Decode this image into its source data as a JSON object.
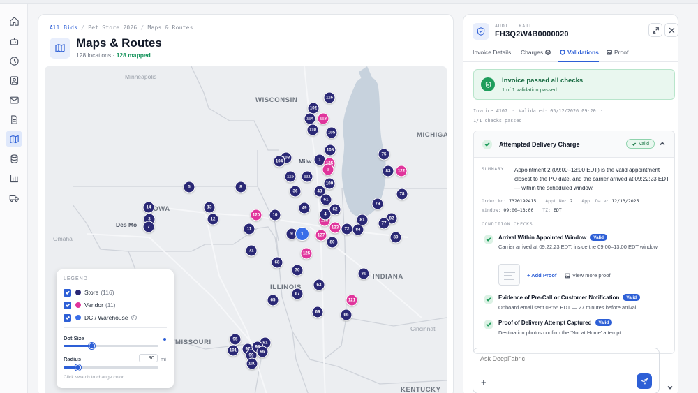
{
  "nav": {
    "items": [
      {
        "id": "home",
        "icon": "home-icon",
        "active": false
      },
      {
        "id": "bot",
        "icon": "robot-icon",
        "active": false
      },
      {
        "id": "history",
        "icon": "clock-icon",
        "active": false
      },
      {
        "id": "contacts",
        "icon": "contact-card-icon",
        "active": false
      },
      {
        "id": "mail",
        "icon": "mail-icon",
        "active": false
      },
      {
        "id": "documents",
        "icon": "document-icon",
        "active": false
      },
      {
        "id": "map",
        "icon": "map-icon",
        "active": true
      },
      {
        "id": "database",
        "icon": "database-icon",
        "active": false
      },
      {
        "id": "analytics",
        "icon": "bar-chart-icon",
        "active": false
      },
      {
        "id": "shipping",
        "icon": "truck-icon",
        "active": false
      }
    ],
    "active_color": "#2d5fd6"
  },
  "breadcrumb": {
    "root": "All Bids",
    "project": "Pet Store 2026",
    "current": "Maps & Routes",
    "separator": "/"
  },
  "page": {
    "title": "Maps & Routes",
    "locations": "128 locations",
    "dot": "·",
    "mapped": "128 mapped"
  },
  "map": {
    "labels": [
      {
        "kind": "place",
        "text": "Minneapolis"
      },
      {
        "kind": "state",
        "text": "WISCONSIN"
      },
      {
        "kind": "state",
        "text": "MICHIGA"
      },
      {
        "kind": "state",
        "text": "IOWA"
      },
      {
        "kind": "city",
        "text": "Des Mo"
      },
      {
        "kind": "place",
        "text": "Omaha"
      },
      {
        "kind": "city",
        "text": "Milw"
      },
      {
        "kind": "state",
        "text": "ILLINOIS"
      },
      {
        "kind": "state",
        "text": "INDIANA"
      },
      {
        "kind": "state",
        "text": "MISSOURI"
      },
      {
        "kind": "place",
        "text": "Cincinnati"
      },
      {
        "kind": "state",
        "text": "KENTUCKY"
      }
    ],
    "markers": [
      {
        "label": "116",
        "type": "store"
      },
      {
        "label": "102",
        "type": "store"
      },
      {
        "label": "114",
        "type": "store"
      },
      {
        "label": "118",
        "type": "vendor"
      },
      {
        "label": "110",
        "type": "store"
      },
      {
        "label": "105",
        "type": "store"
      },
      {
        "label": "108",
        "type": "store"
      },
      {
        "label": "103",
        "type": "store"
      },
      {
        "label": "104",
        "type": "store"
      },
      {
        "label": "1",
        "type": "store"
      },
      {
        "label": "135",
        "type": "vendor"
      },
      {
        "label": "1",
        "type": "vendor"
      },
      {
        "label": "111",
        "type": "store"
      },
      {
        "label": "115",
        "type": "store"
      },
      {
        "label": "109",
        "type": "store"
      },
      {
        "label": "36",
        "type": "store"
      },
      {
        "label": "43",
        "type": "store"
      },
      {
        "label": "61",
        "type": "store"
      },
      {
        "label": "49",
        "type": "store"
      },
      {
        "label": "62",
        "type": "store"
      },
      {
        "label": "5",
        "type": "store"
      },
      {
        "label": "8",
        "type": "store"
      },
      {
        "label": "14",
        "type": "store"
      },
      {
        "label": "13",
        "type": "store"
      },
      {
        "label": "12",
        "type": "store"
      },
      {
        "label": "3",
        "type": "store"
      },
      {
        "label": "7",
        "type": "store"
      },
      {
        "label": "120",
        "type": "vendor"
      },
      {
        "label": "10",
        "type": "store"
      },
      {
        "label": "11",
        "type": "store"
      },
      {
        "label": "9",
        "type": "store"
      },
      {
        "label": "1",
        "type": "dc"
      },
      {
        "label": "128",
        "type": "vendor"
      },
      {
        "label": "123",
        "type": "vendor"
      },
      {
        "label": "127",
        "type": "vendor"
      },
      {
        "label": "72",
        "type": "store"
      },
      {
        "label": "84",
        "type": "store"
      },
      {
        "label": "81",
        "type": "store"
      },
      {
        "label": "80",
        "type": "store"
      },
      {
        "label": "4",
        "type": "store"
      },
      {
        "label": "75",
        "type": "store"
      },
      {
        "label": "83",
        "type": "store"
      },
      {
        "label": "122",
        "type": "vendor"
      },
      {
        "label": "78",
        "type": "store"
      },
      {
        "label": "79",
        "type": "store"
      },
      {
        "label": "82",
        "type": "store"
      },
      {
        "label": "77",
        "type": "store"
      },
      {
        "label": "80",
        "type": "store"
      },
      {
        "label": "71",
        "type": "store"
      },
      {
        "label": "125",
        "type": "vendor"
      },
      {
        "label": "68",
        "type": "store"
      },
      {
        "label": "70",
        "type": "store"
      },
      {
        "label": "31",
        "type": "store"
      },
      {
        "label": "63",
        "type": "store"
      },
      {
        "label": "67",
        "type": "store"
      },
      {
        "label": "65",
        "type": "store"
      },
      {
        "label": "121",
        "type": "vendor"
      },
      {
        "label": "69",
        "type": "store"
      },
      {
        "label": "66",
        "type": "store"
      },
      {
        "label": "95",
        "type": "store"
      },
      {
        "label": "91",
        "type": "store"
      },
      {
        "label": "101",
        "type": "store"
      },
      {
        "label": "97",
        "type": "store"
      },
      {
        "label": "99",
        "type": "store"
      },
      {
        "label": "98",
        "type": "store"
      },
      {
        "label": "96",
        "type": "store"
      },
      {
        "label": "100",
        "type": "store"
      }
    ]
  },
  "legend": {
    "title": "LEGEND",
    "items": [
      {
        "label": "Store",
        "count": "(116)",
        "color": "#2a2875",
        "checked": true
      },
      {
        "label": "Vendor",
        "count": "(11)",
        "color": "#e0359c",
        "checked": true
      },
      {
        "label": "DC / Warehouse",
        "count": "",
        "color": "#3a6ee8",
        "checked": true
      }
    ],
    "info_glyph": "i",
    "dot_size_label": "Dot Size",
    "dot_size_level": 0.3,
    "radius_label": "Radius",
    "radius_value": "90",
    "radius_unit": "mi",
    "radius_level": 0.15,
    "hint": "Click swatch to change color"
  },
  "audit": {
    "kicker": "AUDIT TRAIL",
    "invoice_id": "FH3Q2W4B0000020",
    "tabs": [
      {
        "label": "Invoice Details",
        "active": false
      },
      {
        "label": "Charges",
        "active": false
      },
      {
        "label": "Validations",
        "active": true
      },
      {
        "label": "Proof",
        "active": false
      }
    ],
    "success_title": "Invoice passed all checks",
    "success_sub": "1 of 1 validation passed",
    "meta_invoice": "Invoice #107",
    "meta_validated": "Validated: 05/12/2026 09:20",
    "meta_sep": "·",
    "meta_passed": "1/1 checks passed",
    "check": {
      "title": "Attempted Delivery Charge",
      "status": "Valid",
      "summary_label": "SUMMARY",
      "summary": "Appointment 2 (09:00–13:00 EDT) is the valid appointment closest to the PO date, and the carrier arrived at 09:22:23 EDT — within the scheduled window.",
      "fields": [
        {
          "label": "Order No:",
          "value": "7320192415"
        },
        {
          "label": "Appt No:",
          "value": "2"
        },
        {
          "label": "Appt Date:",
          "value": "12/13/2025"
        },
        {
          "label": "Window:",
          "value": "09:00–13:00"
        },
        {
          "label": "TZ:",
          "value": "EDT"
        }
      ],
      "conditions_label": "CONDITION CHECKS",
      "conditions": [
        {
          "title": "Arrival Within Appointed Window",
          "status": "Valid",
          "desc": "Carrier arrived at 09:22:23 EDT, inside the 09:00–13:00 EDT window."
        },
        {
          "title": "Evidence of Pre-Call or Customer Notification",
          "status": "Valid",
          "desc": "Onboard email sent 08:55 EDT — 27 minutes before arrival."
        },
        {
          "title": "Proof of Delivery Attempt Captured",
          "status": "Valid",
          "desc": "Destination photos confirm the 'Not at Home' attempt."
        }
      ],
      "add_proof": "+ Add Proof",
      "view_proof": "View more proof"
    },
    "chat_placeholder": "Ask DeepFabric",
    "chat_plus": "+"
  },
  "colors": {
    "accent": "#2d5fd6",
    "store": "#2a2875",
    "vendor": "#e0359c",
    "dc": "#3a6ee8",
    "success": "#1f9d5c"
  }
}
